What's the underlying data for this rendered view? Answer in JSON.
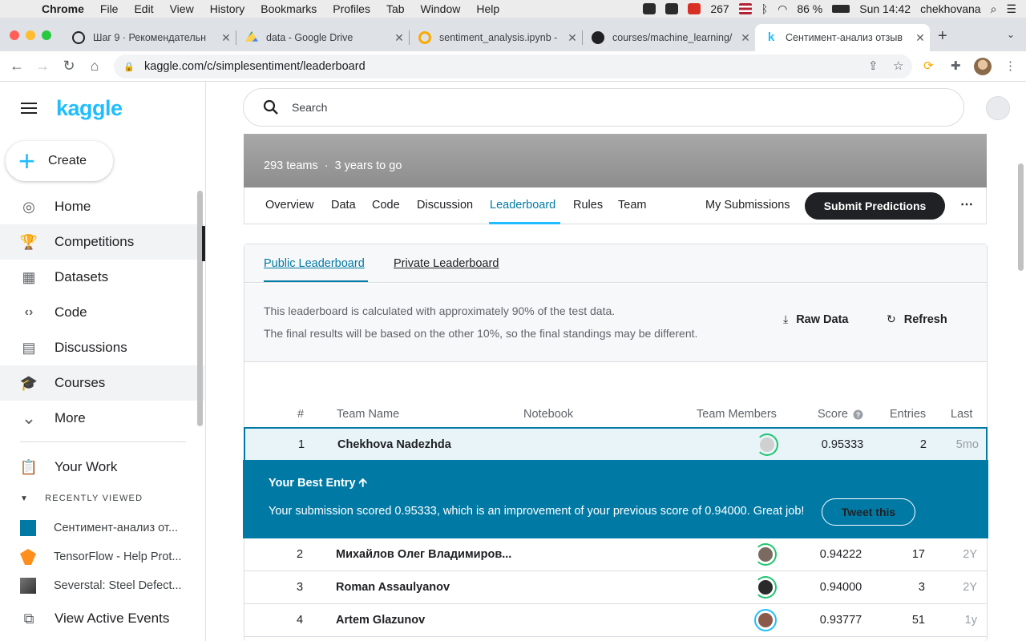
{
  "menubar": {
    "app": "Chrome",
    "items": [
      "File",
      "Edit",
      "View",
      "History",
      "Bookmarks",
      "Profiles",
      "Tab",
      "Window",
      "Help"
    ],
    "mail_count": "267",
    "battery": "86 %",
    "clock": "Sun 14:42",
    "user": "chekhovana"
  },
  "tabs": [
    {
      "title": "Шаг 9 · Рекомендательн",
      "favicon_color": "#202124"
    },
    {
      "title": "data - Google Drive",
      "favicon_color": "#1fa463"
    },
    {
      "title": "sentiment_analysis.ipynb -",
      "favicon_color": "#f9ab00"
    },
    {
      "title": "courses/machine_learning/",
      "favicon_color": "#202124"
    },
    {
      "title": "Сентимент-анализ отзыв",
      "favicon_color": "#20beff"
    }
  ],
  "address": {
    "url": "kaggle.com/c/simplesentiment/leaderboard"
  },
  "sidebar": {
    "logo": "kaggle",
    "create_label": "Create",
    "nav": [
      {
        "label": "Home",
        "icon": "compass-icon",
        "glyph": "◎"
      },
      {
        "label": "Competitions",
        "icon": "trophy-icon",
        "glyph": "🏆"
      },
      {
        "label": "Datasets",
        "icon": "table-icon",
        "glyph": "▦"
      },
      {
        "label": "Code",
        "icon": "code-icon",
        "glyph": "‹›"
      },
      {
        "label": "Discussions",
        "icon": "discussion-icon",
        "glyph": "▤"
      },
      {
        "label": "Courses",
        "icon": "school-icon",
        "glyph": "🎓"
      },
      {
        "label": "More",
        "icon": "chevron-down-icon",
        "glyph": "⌄"
      }
    ],
    "your_work": "Your Work",
    "recently_viewed_heading": "RECENTLY VIEWED",
    "recent": [
      {
        "label": "Сентимент-анализ от...",
        "color": "#007aa5"
      },
      {
        "label": "TensorFlow - Help Prot...",
        "color": "#ff8f1c"
      },
      {
        "label": "Severstal: Steel Defect...",
        "color": "#555555"
      }
    ],
    "view_active_events": "View Active Events"
  },
  "search": {
    "placeholder": "Search"
  },
  "competition": {
    "teams": "293 teams",
    "time_left": "3 years to go",
    "tabs": [
      "Overview",
      "Data",
      "Code",
      "Discussion",
      "Leaderboard",
      "Rules",
      "Team"
    ],
    "active_tab": "Leaderboard",
    "my_submissions": "My Submissions",
    "submit_label": "Submit Predictions"
  },
  "leaderboard": {
    "tabs": [
      "Public Leaderboard",
      "Private Leaderboard"
    ],
    "info_line1": "This leaderboard is calculated with approximately 90% of the test data.",
    "info_line2": "The final results will be based on the other 10%, so the final standings may be different.",
    "raw_data": "Raw Data",
    "refresh": "Refresh",
    "columns": [
      "#",
      "Team Name",
      "Notebook",
      "Team Members",
      "Score",
      "Entries",
      "Last"
    ],
    "rows": [
      {
        "rank": "1",
        "name": "Chekhova Nadezhda",
        "score": "0.95333",
        "entries": "2",
        "last": "5mo",
        "avatar": "#d0d0d0"
      },
      {
        "rank": "2",
        "name": "Михайлов Олег Владимиров...",
        "score": "0.94222",
        "entries": "17",
        "last": "2Y",
        "avatar": "#7a6a60"
      },
      {
        "rank": "3",
        "name": "Roman Assaulyanov",
        "score": "0.94000",
        "entries": "3",
        "last": "2Y",
        "avatar": "#2a2a2a"
      },
      {
        "rank": "4",
        "name": "Artem Glazunov",
        "score": "0.93777",
        "entries": "51",
        "last": "1y",
        "avatar": "#8a5a4a"
      }
    ],
    "best_entry": {
      "heading": "Your Best Entry 🡩",
      "message": "Your submission scored 0.95333, which is an improvement of your previous score of 0.94000. Great job!",
      "tweet": "Tweet this"
    }
  },
  "colors": {
    "kaggle_blue": "#20beff",
    "accent": "#007aa5"
  }
}
